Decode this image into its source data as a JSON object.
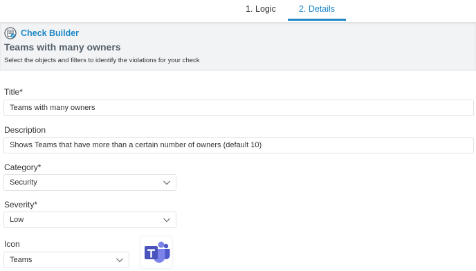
{
  "tabs": [
    {
      "label": "1. Logic",
      "active": false
    },
    {
      "label": "2. Details",
      "active": true
    }
  ],
  "header": {
    "builder_label": "Check Builder",
    "title": "Teams with many owners",
    "subtitle": "Select the objects and filters to identify the violations for your check"
  },
  "form": {
    "title_label": "Title*",
    "title_value": "Teams with many owners",
    "description_label": "Description",
    "description_value": "Shows Teams that have more than a certain number of owners (default 10)",
    "category_label": "Category*",
    "category_value": "Security",
    "severity_label": "Severity*",
    "severity_value": "Low",
    "icon_label": "Icon",
    "icon_value": "Teams"
  },
  "colors": {
    "accent": "#1e88c8",
    "teams_purple": "#5b5fc7"
  },
  "icons": {
    "builder": "check-builder-icon",
    "chevron": "chevron-down-icon",
    "teams": "teams-logo-icon"
  }
}
